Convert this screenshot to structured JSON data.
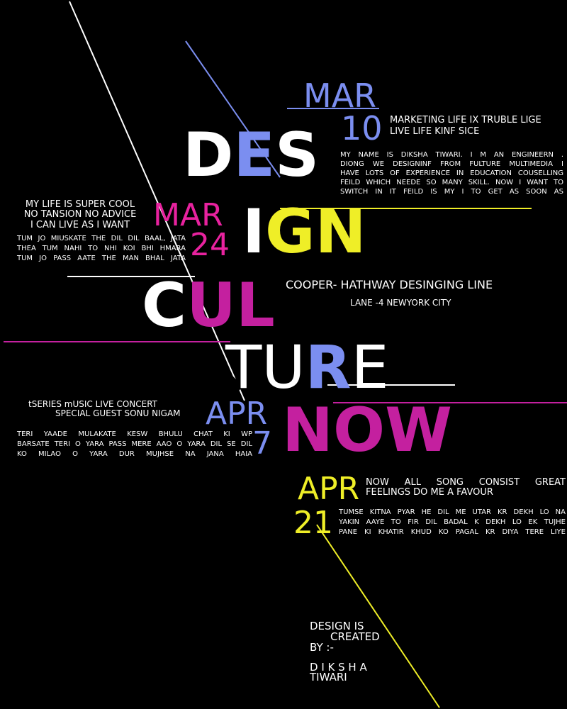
{
  "colors": {
    "background": "#000000",
    "white": "#ffffff",
    "blue": "#7b8ef0",
    "yellow": "#efee27",
    "magenta": "#c4209f",
    "pink": "#e8229f"
  },
  "headline": {
    "des": {
      "d": "D",
      "e": "E",
      "s": "S"
    },
    "ign": {
      "i": "I",
      "gn": "GN"
    },
    "cul": {
      "c": "C",
      "ul": "UL"
    },
    "ture": {
      "tu": "TU",
      "r": "R",
      "e": "E"
    },
    "now": "NOW"
  },
  "events": [
    {
      "month": "MAR",
      "day": "10",
      "title_lines": [
        "MARKETING LIFE IX  TRUBLE LIGE",
        "LIVE LIFE  KINF SICE"
      ],
      "body_lines": [
        "MY NAME IS DIKSHA TIWARI. I M AN ENGINEERN .",
        "DIONG WE DESIGNINF FROM FULTURE MULTIMEDIA  I",
        "HAVE LOTS OF EXPERIENCE IN EDUCATION COUSELLING",
        "FEILD WHICH NEEDE SO MANY SKILL. NOW I WANT TO",
        "SWITCH IN IT FEILD IS MY I TO GET AS SOON AS"
      ]
    },
    {
      "month": "MAR",
      "day": "24",
      "title_lines": [
        "MY LIFE IS SUPER COOL",
        "NO TANSION NO ADVICE",
        "I CAN LIVE AS I WANT"
      ],
      "body_lines": [
        "TUM JO MIUSKATE THE DIL DIL BAAL, JATA",
        "THEA TUM NAHI TO NHI KOI BHI HMARA",
        "TUM JO PASS AATE THE  MAN  BHAL JATA"
      ]
    },
    {
      "month": "APR",
      "day": "7",
      "title_lines": [
        "tSERIES mUSIC LIVE CONCERT",
        "SPECIAL GUEST SONU NIGAM"
      ],
      "body_lines": [
        "TERI YAADE   MULAKATE   KESW BHULU CHAT KI WP",
        "BARSATE TERI O YARA PASS MERE AAO O YARA DIL SE DIL",
        "KO MILAO O YARA DUR MUJHSE NA JANA  HAIA"
      ]
    },
    {
      "month": "APR",
      "day": "21",
      "title_lines": [
        "NOW   ALL   SONG   CONSIST   GREAT",
        "FEELINGS DO ME A FAVOUR"
      ],
      "body_lines": [
        "TUMSE KITNA PYAR HE DIL ME UTAR KR DEKH LO NA",
        "YAKIN AAYE TO FIR DIL BADAL K DEKH LO   EK TUJHE",
        "PANE KI KHATIR KHUD KO PAGAL KR DIYA   TERE LIYE"
      ]
    }
  ],
  "venue": {
    "line1": "COOPER- HATHWAY DESINGING LINE",
    "line2": "LANE -4 NEWYORK CITY"
  },
  "credit": {
    "line1": "DESIGN  IS",
    "line2": "CREATED",
    "line3": "BY :-",
    "name1": "D I K S H A",
    "name2": "TIWARI"
  }
}
